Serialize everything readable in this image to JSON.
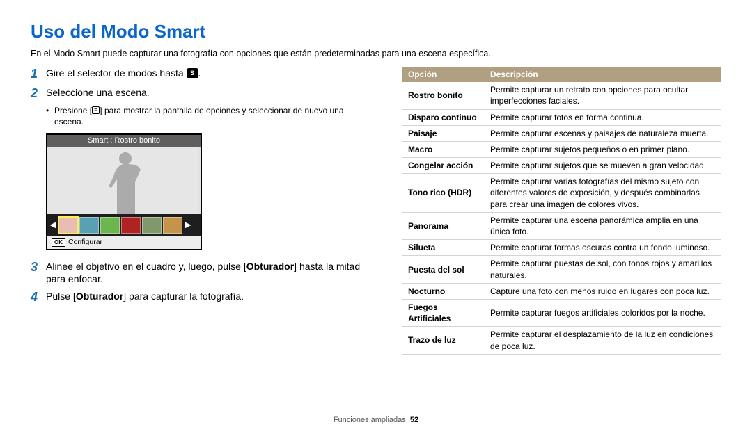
{
  "title": "Uso del Modo Smart",
  "intro": "En el Modo Smart puede capturar una fotografía con opciones que están predeterminadas para una escena específica.",
  "steps": {
    "s1": {
      "num": "1",
      "pre": "Gire el selector de modos hasta ",
      "icon": "S",
      "post": "."
    },
    "s2": {
      "num": "2",
      "text": "Seleccione una escena."
    },
    "s2_sub": {
      "pre": "Presione [",
      "post": "] para mostrar la pantalla de opciones y seleccionar de nuevo una escena."
    },
    "s3": {
      "num": "3",
      "pre": "Alinee el objetivo en el cuadro y, luego, pulse [",
      "bold": "Obturador",
      "post": "] hasta la mitad para enfocar."
    },
    "s4": {
      "num": "4",
      "pre": "Pulse [",
      "bold": "Obturador",
      "post": "] para capturar la fotografía."
    }
  },
  "camera": {
    "top_label": "Smart : Rostro bonito",
    "bottom_label": "Configurar",
    "ok": "OK"
  },
  "table": {
    "head": {
      "opt": "Opción",
      "desc": "Descripción"
    },
    "rows": [
      {
        "name": "Rostro bonito",
        "desc": "Permite capturar un retrato con opciones para ocultar imperfecciones faciales."
      },
      {
        "name": "Disparo continuo",
        "desc": "Permite capturar fotos en forma continua."
      },
      {
        "name": "Paisaje",
        "desc": "Permite capturar escenas y paisajes de naturaleza muerta."
      },
      {
        "name": "Macro",
        "desc": "Permite capturar sujetos pequeños o en primer plano."
      },
      {
        "name": "Congelar acción",
        "desc": "Permite capturar sujetos que se mueven a gran velocidad."
      },
      {
        "name": "Tono rico (HDR)",
        "desc": "Permite capturar varias fotografías del mismo sujeto con diferentes valores de exposición, y después combinarlas para crear una imagen de colores vivos."
      },
      {
        "name": "Panorama",
        "desc": "Permite capturar una escena panorámica amplia en una única foto."
      },
      {
        "name": "Silueta",
        "desc": "Permite capturar formas oscuras contra un fondo luminoso."
      },
      {
        "name": "Puesta del sol",
        "desc": "Permite capturar puestas de sol, con tonos rojos y amarillos naturales."
      },
      {
        "name": "Nocturno",
        "desc": "Capture una foto con menos ruido en lugares con poca luz."
      },
      {
        "name": "Fuegos Artificiales",
        "desc": "Permite capturar fuegos artificiales coloridos por la noche."
      },
      {
        "name": "Trazo de luz",
        "desc": "Permite capturar el desplazamiento de la luz en condiciones de poca luz."
      }
    ]
  },
  "footer": {
    "section": "Funciones ampliadas",
    "page": "52"
  },
  "thumbs": [
    "#e9bdb3",
    "#5aa0b3",
    "#6bb64e",
    "#b02323",
    "#7f996b",
    "#c3944a"
  ]
}
